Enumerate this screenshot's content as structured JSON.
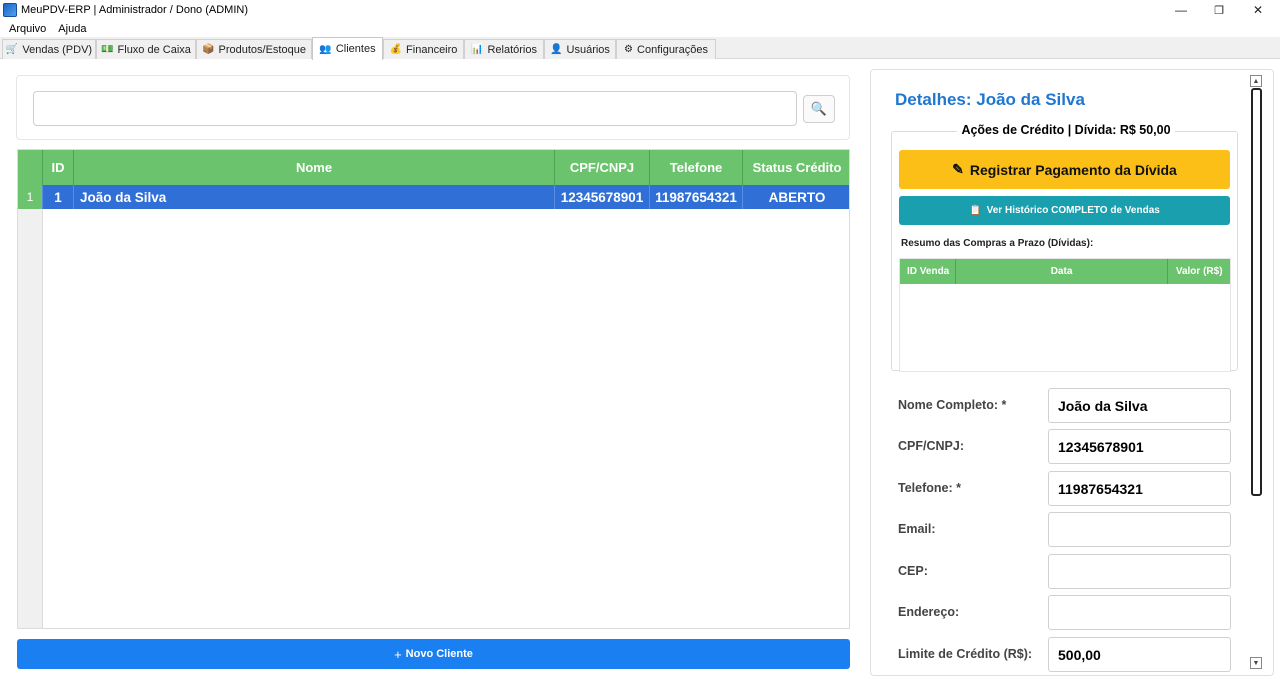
{
  "window": {
    "title": "MeuPDV-ERP  |  Administrador / Dono (ADMIN)",
    "minimize": "—",
    "maximize": "❐",
    "close": "✕"
  },
  "menu": {
    "items": [
      "Arquivo",
      "Ajuda"
    ]
  },
  "tabs": [
    {
      "label": "Vendas (PDV)",
      "icon": "🛒",
      "icon_name": "cart-icon"
    },
    {
      "label": "Fluxo de Caixa",
      "icon": "💵",
      "icon_name": "cash-icon"
    },
    {
      "label": "Produtos/Estoque",
      "icon": "📦",
      "icon_name": "box-icon"
    },
    {
      "label": "Clientes",
      "icon": "👥",
      "icon_name": "users-icon"
    },
    {
      "label": "Financeiro",
      "icon": "💰",
      "icon_name": "money-bag-icon"
    },
    {
      "label": "Relatórios",
      "icon": "📊",
      "icon_name": "chart-icon"
    },
    {
      "label": "Usuários",
      "icon": "👤",
      "icon_name": "user-icon"
    },
    {
      "label": "Configurações",
      "icon": "⚙",
      "icon_name": "gear-icon"
    }
  ],
  "active_tab": "Clientes",
  "search": {
    "value": "",
    "button_icon": "🔍"
  },
  "clients_table": {
    "columns": [
      "ID",
      "Nome",
      "CPF/CNPJ",
      "Telefone",
      "Status Crédito"
    ],
    "rows": [
      {
        "row_number": "1",
        "id": "1",
        "nome": "João da Silva",
        "cpf": "12345678901",
        "telefone": "11987654321",
        "status": "ABERTO"
      }
    ]
  },
  "new_client_button": {
    "icon": "+",
    "label": "Novo Cliente"
  },
  "details": {
    "title": "Detalhes: João da Silva",
    "credit_group_title": "Ações de Crédito | Dívida: R$ 50,00",
    "pay_button": {
      "icon": "✎",
      "label": "Registrar Pagamento da Dívida"
    },
    "history_button": {
      "icon": "📋",
      "label": "Ver Histórico COMPLETO de Vendas"
    },
    "summary_label": "Resumo das Compras a Prazo (Dívidas):",
    "summary_columns": [
      "ID Venda",
      "Data",
      "Valor (R$)"
    ],
    "form": {
      "nome_label": "Nome Completo: *",
      "nome_value": "João da Silva",
      "cpf_label": "CPF/CNPJ:",
      "cpf_value": "12345678901",
      "telefone_label": "Telefone: *",
      "telefone_value": "11987654321",
      "email_label": "Email:",
      "email_value": "",
      "cep_label": "CEP:",
      "cep_value": "",
      "endereco_label": "Endereço:",
      "endereco_value": "",
      "limite_label": "Limite de Crédito (R$):",
      "limite_value": "500,00"
    }
  },
  "colors": {
    "grid_header": "#6cc36e",
    "selection": "#2f6fd6",
    "primary_button": "#1a7ff0",
    "warning_button": "#fbbf18",
    "info_button": "#1a9fae",
    "title_blue": "#1f77d0"
  }
}
